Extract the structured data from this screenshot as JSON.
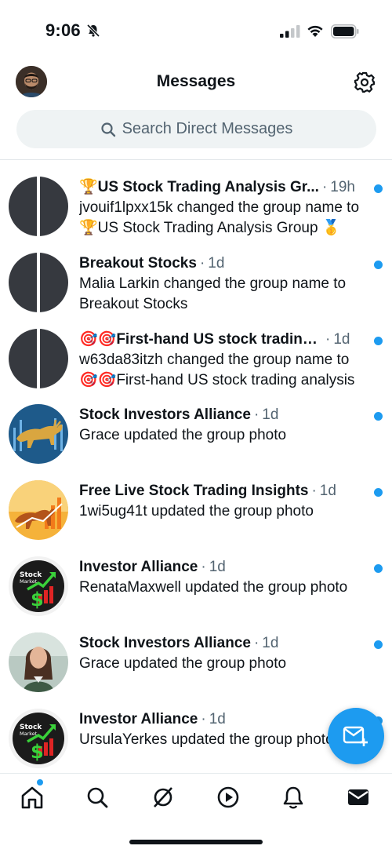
{
  "status_bar": {
    "time": "9:06"
  },
  "header": {
    "title": "Messages"
  },
  "search": {
    "placeholder": "Search Direct Messages"
  },
  "conversations": [
    {
      "name": "🏆US Stock Trading Analysis Gr...",
      "time": "19h",
      "line1": "jvouif1lpxx15k changed the group name to",
      "line2": "🏆US Stock Trading Analysis Group 🥇",
      "unread": true,
      "avatar": "group-default"
    },
    {
      "name": "Breakout Stocks",
      "time": "1d",
      "line1": "Malia Larkin changed the group name to",
      "line2": "Breakout Stocks",
      "unread": true,
      "avatar": "group-default"
    },
    {
      "name": "🎯🎯First-hand US stock trading...",
      "time": "1d",
      "line1": "w63da83itzh changed the group name to",
      "line2": "🎯🎯First-hand US stock trading analysis",
      "unread": true,
      "avatar": "group-default"
    },
    {
      "name": "Stock Investors Alliance",
      "time": "1d",
      "line1": "Grace updated the group photo",
      "line2": "",
      "unread": true,
      "avatar": "bull-blue"
    },
    {
      "name": "Free Live Stock Trading Insights",
      "time": "1d",
      "line1": "1wi5ug41t updated the group photo",
      "line2": "",
      "unread": true,
      "avatar": "bull-orange"
    },
    {
      "name": "Investor Alliance",
      "time": "1d",
      "line1": "RenataMaxwell updated the group photo",
      "line2": "",
      "unread": true,
      "avatar": "stock-market"
    },
    {
      "name": "Stock Investors Alliance",
      "time": "1d",
      "line1": "Grace updated the group photo",
      "line2": "",
      "unread": true,
      "avatar": "woman-photo"
    },
    {
      "name": "Investor Alliance",
      "time": "1d",
      "line1": "UrsulaYerkes updated the group photo",
      "line2": "",
      "unread": true,
      "avatar": "stock-market"
    }
  ],
  "stock_market_logo": {
    "line1": "Stock",
    "line2": "Market"
  },
  "tabs": [
    "home",
    "search",
    "grok",
    "video",
    "notifications",
    "messages"
  ],
  "colors": {
    "accent": "#1d9bf0",
    "text": "#0f1419",
    "muted": "#536471",
    "search_bg": "#eff3f4"
  }
}
